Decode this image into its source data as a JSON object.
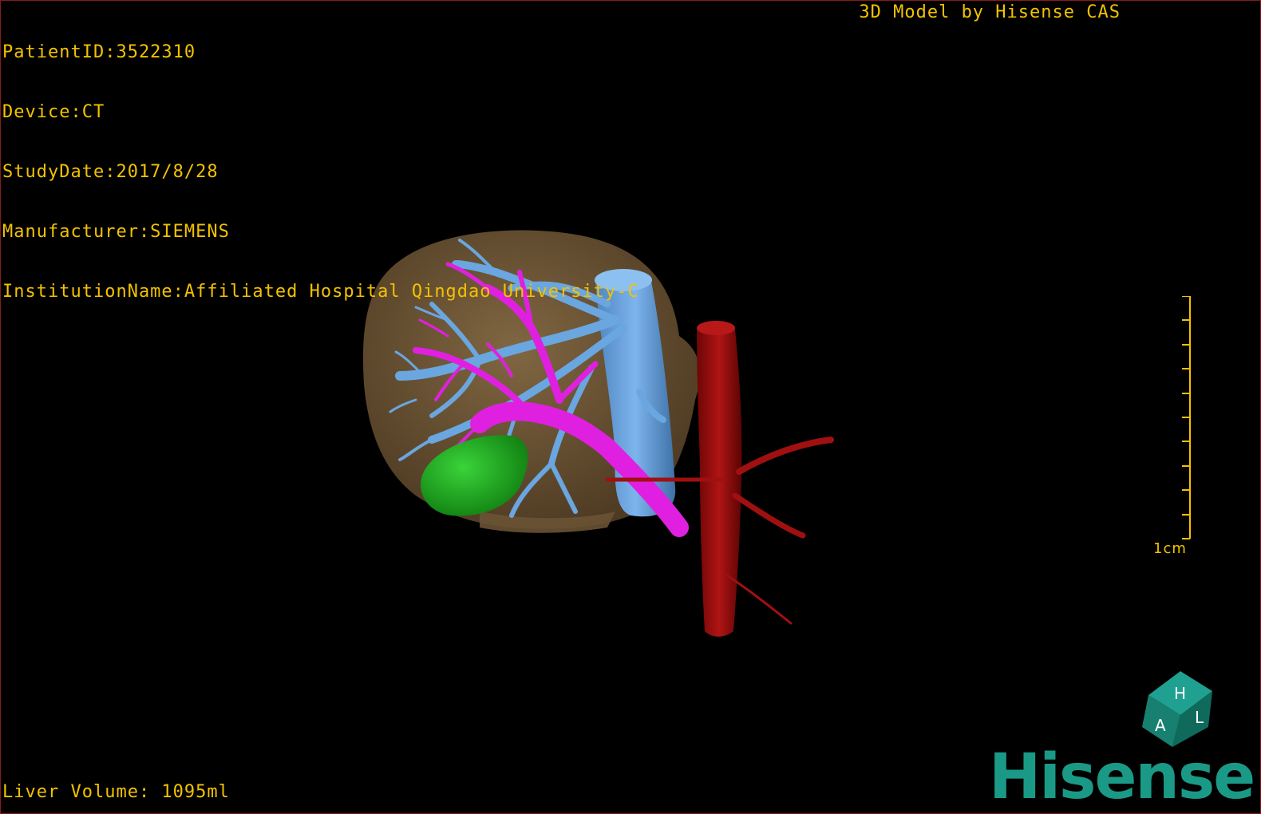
{
  "patient": {
    "id_line": "PatientID:3522310",
    "device_line": "Device:CT",
    "study_date_line": "StudyDate:2017/8/28",
    "manufacturer_line": "Manufacturer:SIEMENS",
    "institution_line": "InstitutionName:Affiliated Hospital Qingdao University-C"
  },
  "viewer": {
    "title": "3D Model by Hisense CAS",
    "liver_volume": "Liver Volume: 1095ml",
    "scale_label": "1cm",
    "scale_ticks": 10
  },
  "orientation_cube": {
    "labels": [
      "H",
      "A",
      "L"
    ],
    "color": "#1a8a7a"
  },
  "brand": {
    "name": "Hisense",
    "color": "#1a9a86"
  },
  "model": {
    "structures": [
      "liver",
      "hepatic-veins",
      "portal-vein",
      "inferior-vena-cava",
      "aorta",
      "gallbladder"
    ],
    "colors": {
      "liver": "#7a6040",
      "hepatic-veins": "#6aa6e0",
      "portal-vein": "#e020e0",
      "inferior-vena-cava": "#6aa6e0",
      "aorta": "#9a0c0c",
      "gallbladder": "#1aa01a"
    }
  },
  "colors": {
    "overlay_text": "#f2c200",
    "background": "#000000",
    "frame_border": "#8a1a1a"
  }
}
